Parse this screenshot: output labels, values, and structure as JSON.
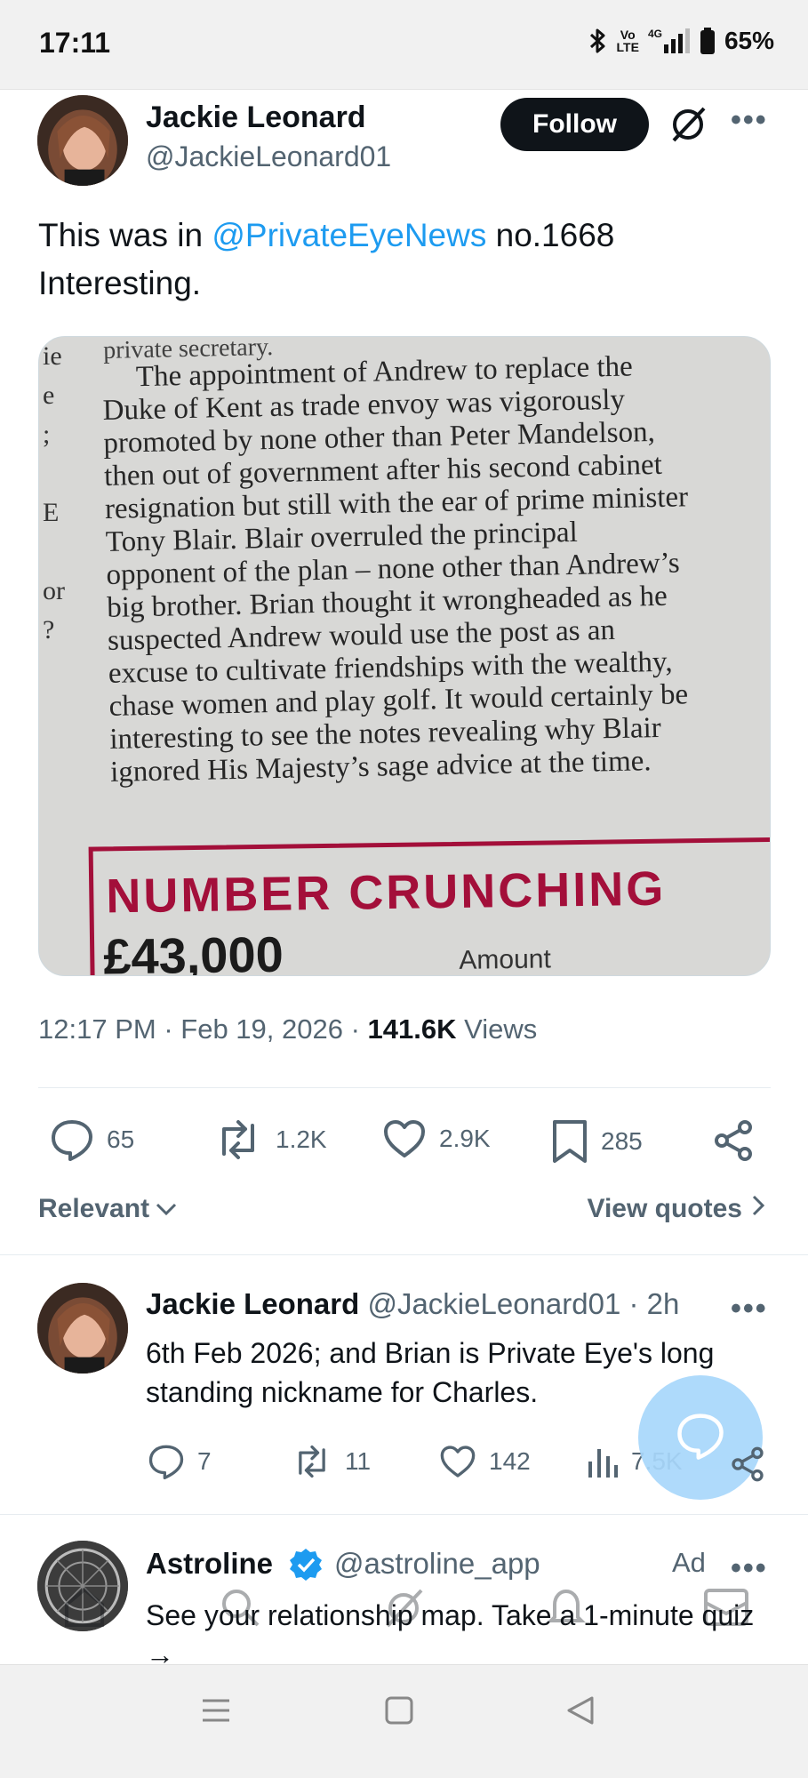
{
  "status_bar": {
    "time": "17:11",
    "lte_top": "Vo",
    "lte_bottom": "LTE",
    "network": "4G",
    "battery": "65%"
  },
  "tweet": {
    "author_name": "Jackie Leonard",
    "author_handle": "@JackieLeonard01",
    "follow_label": "Follow",
    "text_prefix": "This was in ",
    "mention": "@PrivateEyeNews",
    "text_suffix": " no.1668",
    "text_line2": "Interesting.",
    "media": {
      "top_fragment": "private secretary.",
      "lines": [
        "The appointment of Andrew to replace the",
        "Duke of Kent as trade envoy was vigorously",
        "promoted by none other than Peter Mandelson,",
        "then out of government after his second cabinet",
        "resignation but still with the ear of prime minister",
        "Tony Blair. Blair overruled the principal",
        "opponent of the plan – none other than Andrew’s",
        "big brother. Brian thought it wrongheaded as he",
        "suspected Andrew would use the post as an",
        "excuse to cultivate friendships with the wealthy,",
        "chase women and play golf. It would certainly be",
        "interesting to see the notes revealing why Blair",
        "ignored His Majesty’s sage advice at the time."
      ],
      "margin_chars": [
        "ie",
        "e",
        ";",
        "",
        "E",
        "",
        "or",
        "?"
      ],
      "box_title": "NUMBER CRUNCHING",
      "box_amount": "£43,000",
      "box_amount_label": "Amount"
    },
    "time": "12:17 PM",
    "date": "Feb 19, 2026",
    "views_count": "141.6K",
    "views_label": "Views",
    "stats": {
      "replies": "65",
      "retweets": "1.2K",
      "likes": "2.9K",
      "bookmarks": "285"
    }
  },
  "sort": {
    "relevant_label": "Relevant",
    "view_quotes_label": "View quotes"
  },
  "reply": {
    "author_name": "Jackie Leonard",
    "author_handle": "@JackieLeonard01",
    "age": "· 2h",
    "text": "6th Feb 2026; and Brian is Private Eye's long standing nickname for Charles.",
    "stats": {
      "replies": "7",
      "retweets": "11",
      "likes": "142",
      "views": "7.5K"
    }
  },
  "ad": {
    "author_name": "Astroline",
    "author_handle": "@astroline_app",
    "ad_label": "Ad",
    "text": "See your relationship map. Take a 1-minute quiz →"
  },
  "colors": {
    "accent": "#1d9bf0",
    "text": "#0f1419",
    "muted": "#536471",
    "fab": "#a8d7fb",
    "crunch_red": "#a30f3a"
  }
}
